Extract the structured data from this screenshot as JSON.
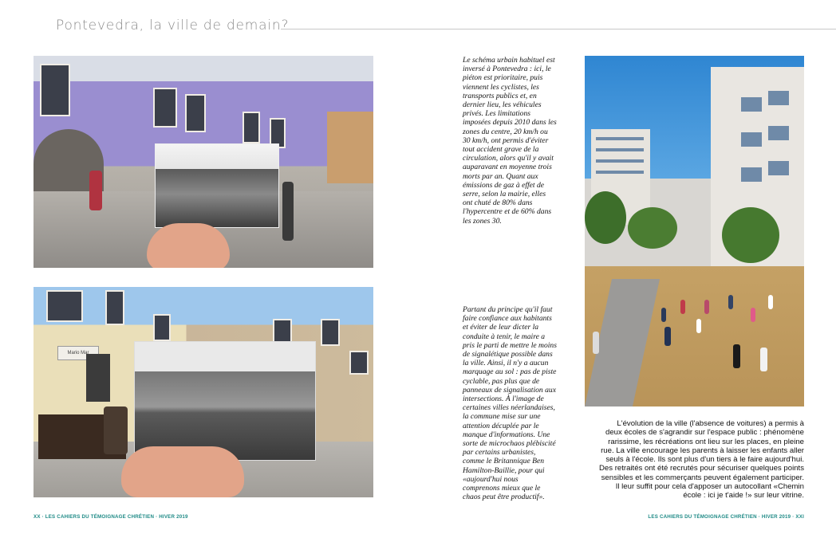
{
  "header": {
    "title": "Pontevedra, la ville de demain?"
  },
  "column_1": "Le schéma urbain habituel est inversé à Pontevedra : ici, le piéton est prioritaire, puis viennent les cyclistes, les transports publics et, en dernier lieu, les véhicules privés. Les limitations imposées depuis 2010 dans les zones du centre, 20 km/h ou 30 km/h, ont permis d'éviter tout accident grave de la circulation, alors qu'il y avait auparavant en moyenne trois morts par an. Quant aux émissions de gaz à effet de serre, selon la mairie, elles ont chuté de 80% dans l'hypercentre et de 60% dans les zones 30.",
  "column_2": "Partant du principe qu'il faut faire confiance aux habitants et éviter de leur dicter la conduite à tenir, le maire a pris le parti de mettre le moins de signalétique possible dans la ville. Ainsi, il n'y a aucun marquage au sol : pas de piste cyclable, pas plus que de panneaux de signalisation aux intersections. À l'image de certaines villes néerlandaises, la commune mise sur une attention décuplée par le manque d'informations. Une sorte de microchaos plébiscité par certains urbanistes, comme le Britannique Ben Hamilton-Baillie, pour qui «aujourd'hui nous comprenons mieux que le chaos peut être productif».",
  "caption": "L'évolution de la ville (l'absence de voitures) a permis à deux écoles de s'agrandir sur l'espace public : phénomène rarissime, les récréations ont lieu sur les places, en pleine rue. La ville encourage les parents à laisser les enfants aller seuls à l'école. Ils sont plus d'un tiers à le faire aujourd'hui. Des retraités ont été recrutés pour sécuriser quelques points sensibles et les commerçants peuvent également participer. Il leur suffit pour cela d'apposer un autocollant «Chemin école : ici je t'aide !» sur leur vitrine.",
  "folio": {
    "left": "XX · LES CAHIERS DU TÉMOIGNAGE CHRÉTIEN · HIVER 2019",
    "right": "LES CAHIERS DU TÉMOIGNAGE CHRÉTIEN · HIVER 2019 · XXI"
  },
  "photo_sign": "Mario Mar",
  "colors": {
    "accent": "#1e8a86",
    "header_text": "#8d8d8d"
  }
}
